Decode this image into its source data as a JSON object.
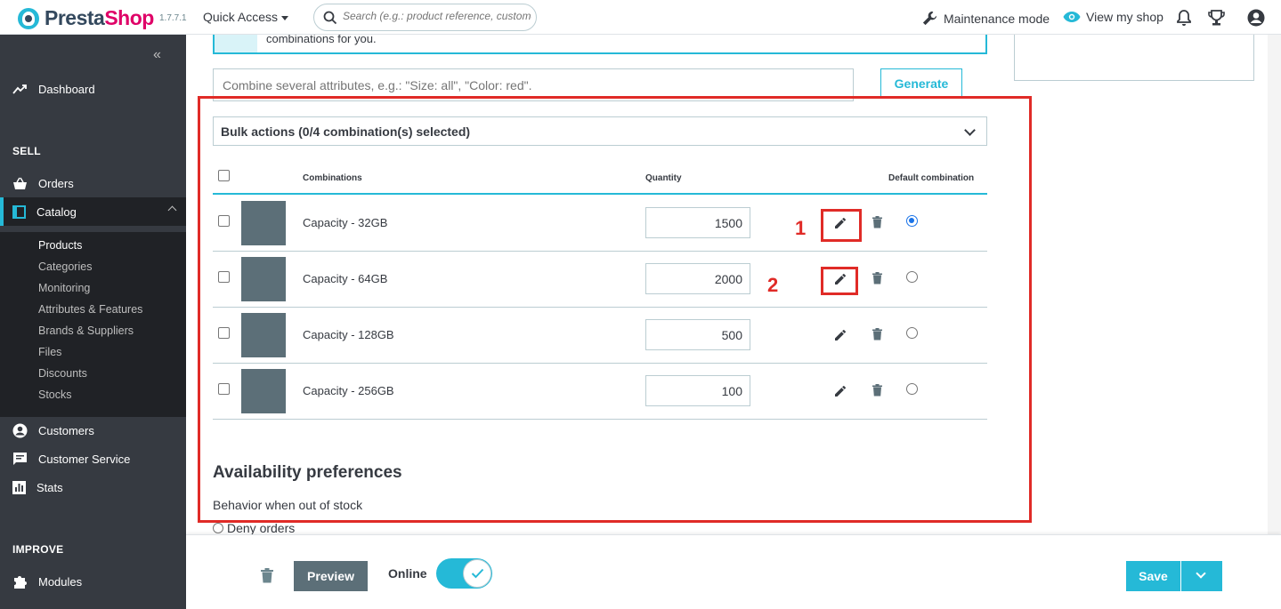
{
  "header": {
    "brand_prefix": "Presta",
    "brand_suffix": "Shop",
    "version": "1.7.7.1",
    "quick_access": "Quick Access",
    "search_placeholder": "Search (e.g.: product reference, custome",
    "maintenance": "Maintenance mode",
    "view_shop": "View my shop"
  },
  "sidebar": {
    "dashboard": "Dashboard",
    "sell_section": "SELL",
    "orders": "Orders",
    "catalog": "Catalog",
    "catalog_items": [
      "Products",
      "Categories",
      "Monitoring",
      "Attributes & Features",
      "Brands & Suppliers",
      "Files",
      "Discounts",
      "Stocks"
    ],
    "customers": "Customers",
    "customer_service": "Customer Service",
    "stats": "Stats",
    "improve_section": "IMPROVE",
    "modules": "Modules"
  },
  "main": {
    "info_text": "combinations for you.",
    "attr_placeholder": "Combine several attributes, e.g.: \"Size: all\", \"Color: red\".",
    "generate": "Generate",
    "bulk_actions": "Bulk actions (0/4 combination(s) selected)",
    "columns": {
      "combinations": "Combinations",
      "quantity": "Quantity",
      "default": "Default combination"
    },
    "rows": [
      {
        "label": "Capacity - 32GB",
        "quantity": "1500",
        "default": true
      },
      {
        "label": "Capacity - 64GB",
        "quantity": "2000",
        "default": false
      },
      {
        "label": "Capacity - 128GB",
        "quantity": "500",
        "default": false
      },
      {
        "label": "Capacity - 256GB",
        "quantity": "100",
        "default": false
      }
    ],
    "availability_title": "Availability preferences",
    "behavior_label": "Behavior when out of stock",
    "deny_orders": "Deny orders"
  },
  "annotations": [
    "1",
    "2"
  ],
  "footer": {
    "preview": "Preview",
    "online": "Online",
    "online_enabled": true,
    "save": "Save"
  },
  "colors": {
    "accent": "#25b9d7",
    "sidebar": "#363a41",
    "annotation": "#e02b27"
  }
}
